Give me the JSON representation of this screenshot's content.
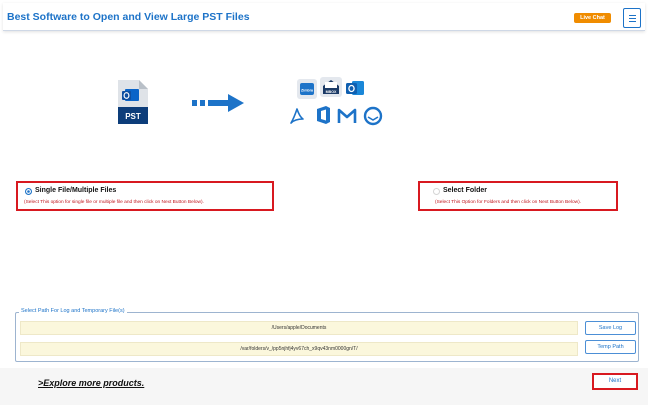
{
  "header": {
    "title": "Best Software to Open and View Large PST Files",
    "live_chat_label": "Live Chat",
    "menu_icon": "hamburger-icon"
  },
  "source": {
    "file_label": "PST",
    "icon": "pst-file-icon",
    "arrow_icon": "arrow-right-icon"
  },
  "targets": {
    "icons": [
      "zimbra-icon",
      "mbox-icon",
      "outlook-icon",
      "pdf-icon",
      "office365-icon",
      "gmail-icon",
      "thunderbird-icon"
    ],
    "zimbra_label": "Zimbra",
    "mbox_label": "MBOX"
  },
  "options": {
    "single": {
      "label": "Single File/Multiple Files",
      "description": "(Select This option for single file or multiple file and then click on Next Button Below).",
      "selected": true
    },
    "folder": {
      "label": "Select Folder",
      "description": "(Select This Option for Folders and then click on Next Button Below).",
      "selected": false
    }
  },
  "paths": {
    "legend": "Select Path For Log and Temporary File(s)",
    "log_path": "/Users/apple/Documents",
    "temp_path": "/var/folders/v_/pp5njhfj4yv67ch_x9qv43nm0000gn/T/",
    "save_log_label": "Save Log",
    "temp_path_label": "Temp Path"
  },
  "footer": {
    "explore_label": ">Explore more products.",
    "next_label": "Next"
  },
  "colors": {
    "accent": "#1d73c8",
    "highlight_red": "#d81920",
    "live_chat": "#f08c00",
    "path_field": "#fbf7dc"
  }
}
